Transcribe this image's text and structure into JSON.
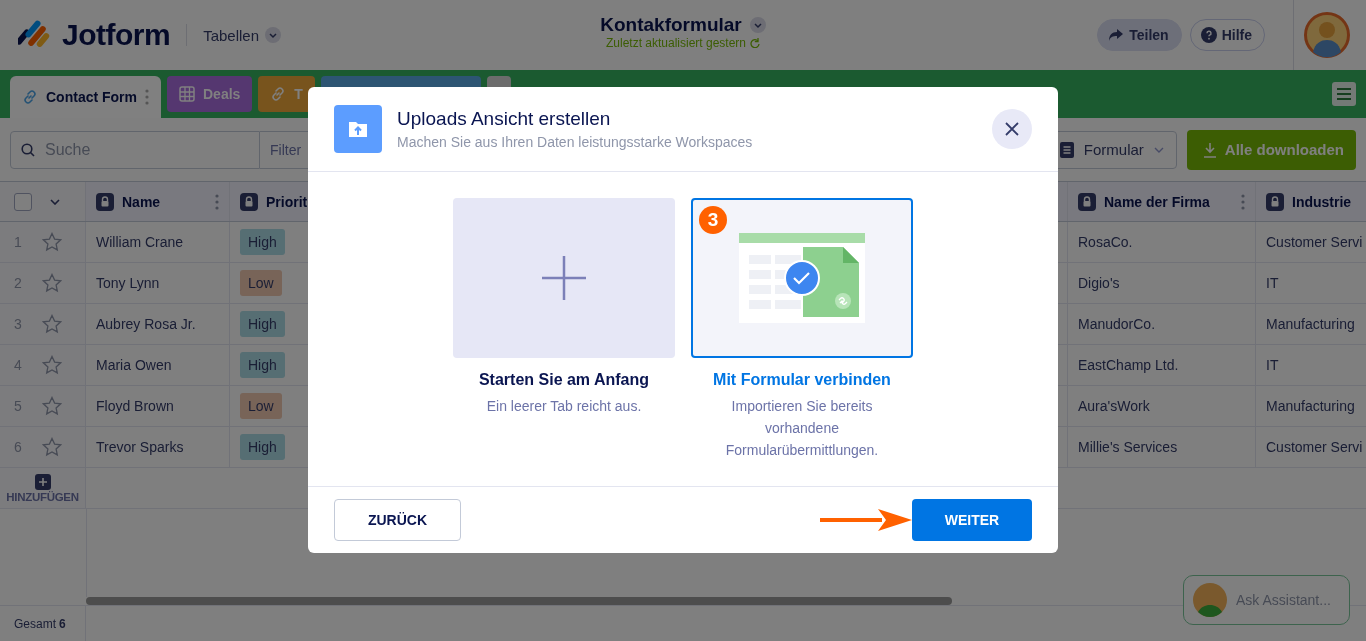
{
  "header": {
    "brand": "Jotform",
    "section_menu": "Tabellen",
    "title": "Kontakformular",
    "subtitle": "Zuletzt aktualisiert gestern",
    "buttons": [
      {
        "label": "Teilen",
        "kind": "share"
      },
      {
        "label": "Hilfe",
        "kind": "help"
      }
    ]
  },
  "tabs": [
    {
      "label": "Contact Form",
      "selected": true,
      "color": "#808080",
      "kind": "link"
    },
    {
      "label": "Deals",
      "selected": false,
      "color": "#553770",
      "kind": "grid"
    },
    {
      "label": "T",
      "selected": false,
      "color": "#78541d",
      "kind": "link"
    },
    {
      "selected": false,
      "color": "#2d5573",
      "kind": "blank"
    },
    {
      "selected": false,
      "color": "#6c6c6c",
      "kind": "blank"
    }
  ],
  "toolbar": {
    "search_placeholder": "Suche",
    "filter": "Filter",
    "view_menu": "Formular",
    "download": "Alle downloaden"
  },
  "table": {
    "select_all_checked": false,
    "columns": [
      {
        "label": "Name"
      },
      {
        "label": "Priorit"
      },
      {
        "label": "Name der Firma"
      },
      {
        "label": "Industrie"
      }
    ],
    "rows": [
      {
        "number": "1",
        "starred": false,
        "name": "William Crane",
        "priority": {
          "label": "High",
          "color": "#566e73"
        },
        "company": "RosaCo.",
        "industry": "Customer Servi"
      },
      {
        "number": "2",
        "starred": false,
        "name": "Tony Lynn",
        "priority": {
          "label": "Low",
          "color": "#786458"
        },
        "company": "Digio's",
        "industry": "IT"
      },
      {
        "number": "3",
        "starred": false,
        "name": "Aubrey Rosa Jr.",
        "priority": {
          "label": "High",
          "color": "#566e73"
        },
        "company": "ManudorCo.",
        "industry": "Manufacturing"
      },
      {
        "number": "4",
        "starred": false,
        "name": "Maria Owen",
        "priority": {
          "label": "High",
          "color": "#566e73"
        },
        "company": "EastChamp Ltd.",
        "industry": "IT"
      },
      {
        "number": "5",
        "starred": false,
        "name": "Floyd Brown",
        "priority": {
          "label": "Low",
          "color": "#786458"
        },
        "company": "Aura'sWork",
        "industry": "Manufacturing"
      },
      {
        "number": "6",
        "starred": false,
        "name": "Trevor Sparks",
        "priority": {
          "label": "High",
          "color": "#566e73"
        },
        "company": "Millie's Services",
        "industry": "Customer Servi"
      }
    ],
    "add_label": "HINZUFÜGEN",
    "total_label": "Gesamt",
    "total": "6"
  },
  "assistant": {
    "label": "Ask Assistant..."
  },
  "dialog": {
    "title": "Uploads Ansicht erstellen",
    "subtitle": "Machen Sie aus Ihren Daten leistungsstarke Workspaces",
    "options": [
      {
        "title": "Starten Sie am Anfang",
        "description": "Ein leerer Tab reicht aus.",
        "selected": false,
        "kind": "blank"
      },
      {
        "title": "Mit Formular verbinden",
        "description": "Importieren Sie bereits vorhandene Formularübermittlungen.",
        "selected": true,
        "kind": "form",
        "badge": "3"
      }
    ],
    "back": "ZURÜCK",
    "next": "WEITER"
  }
}
